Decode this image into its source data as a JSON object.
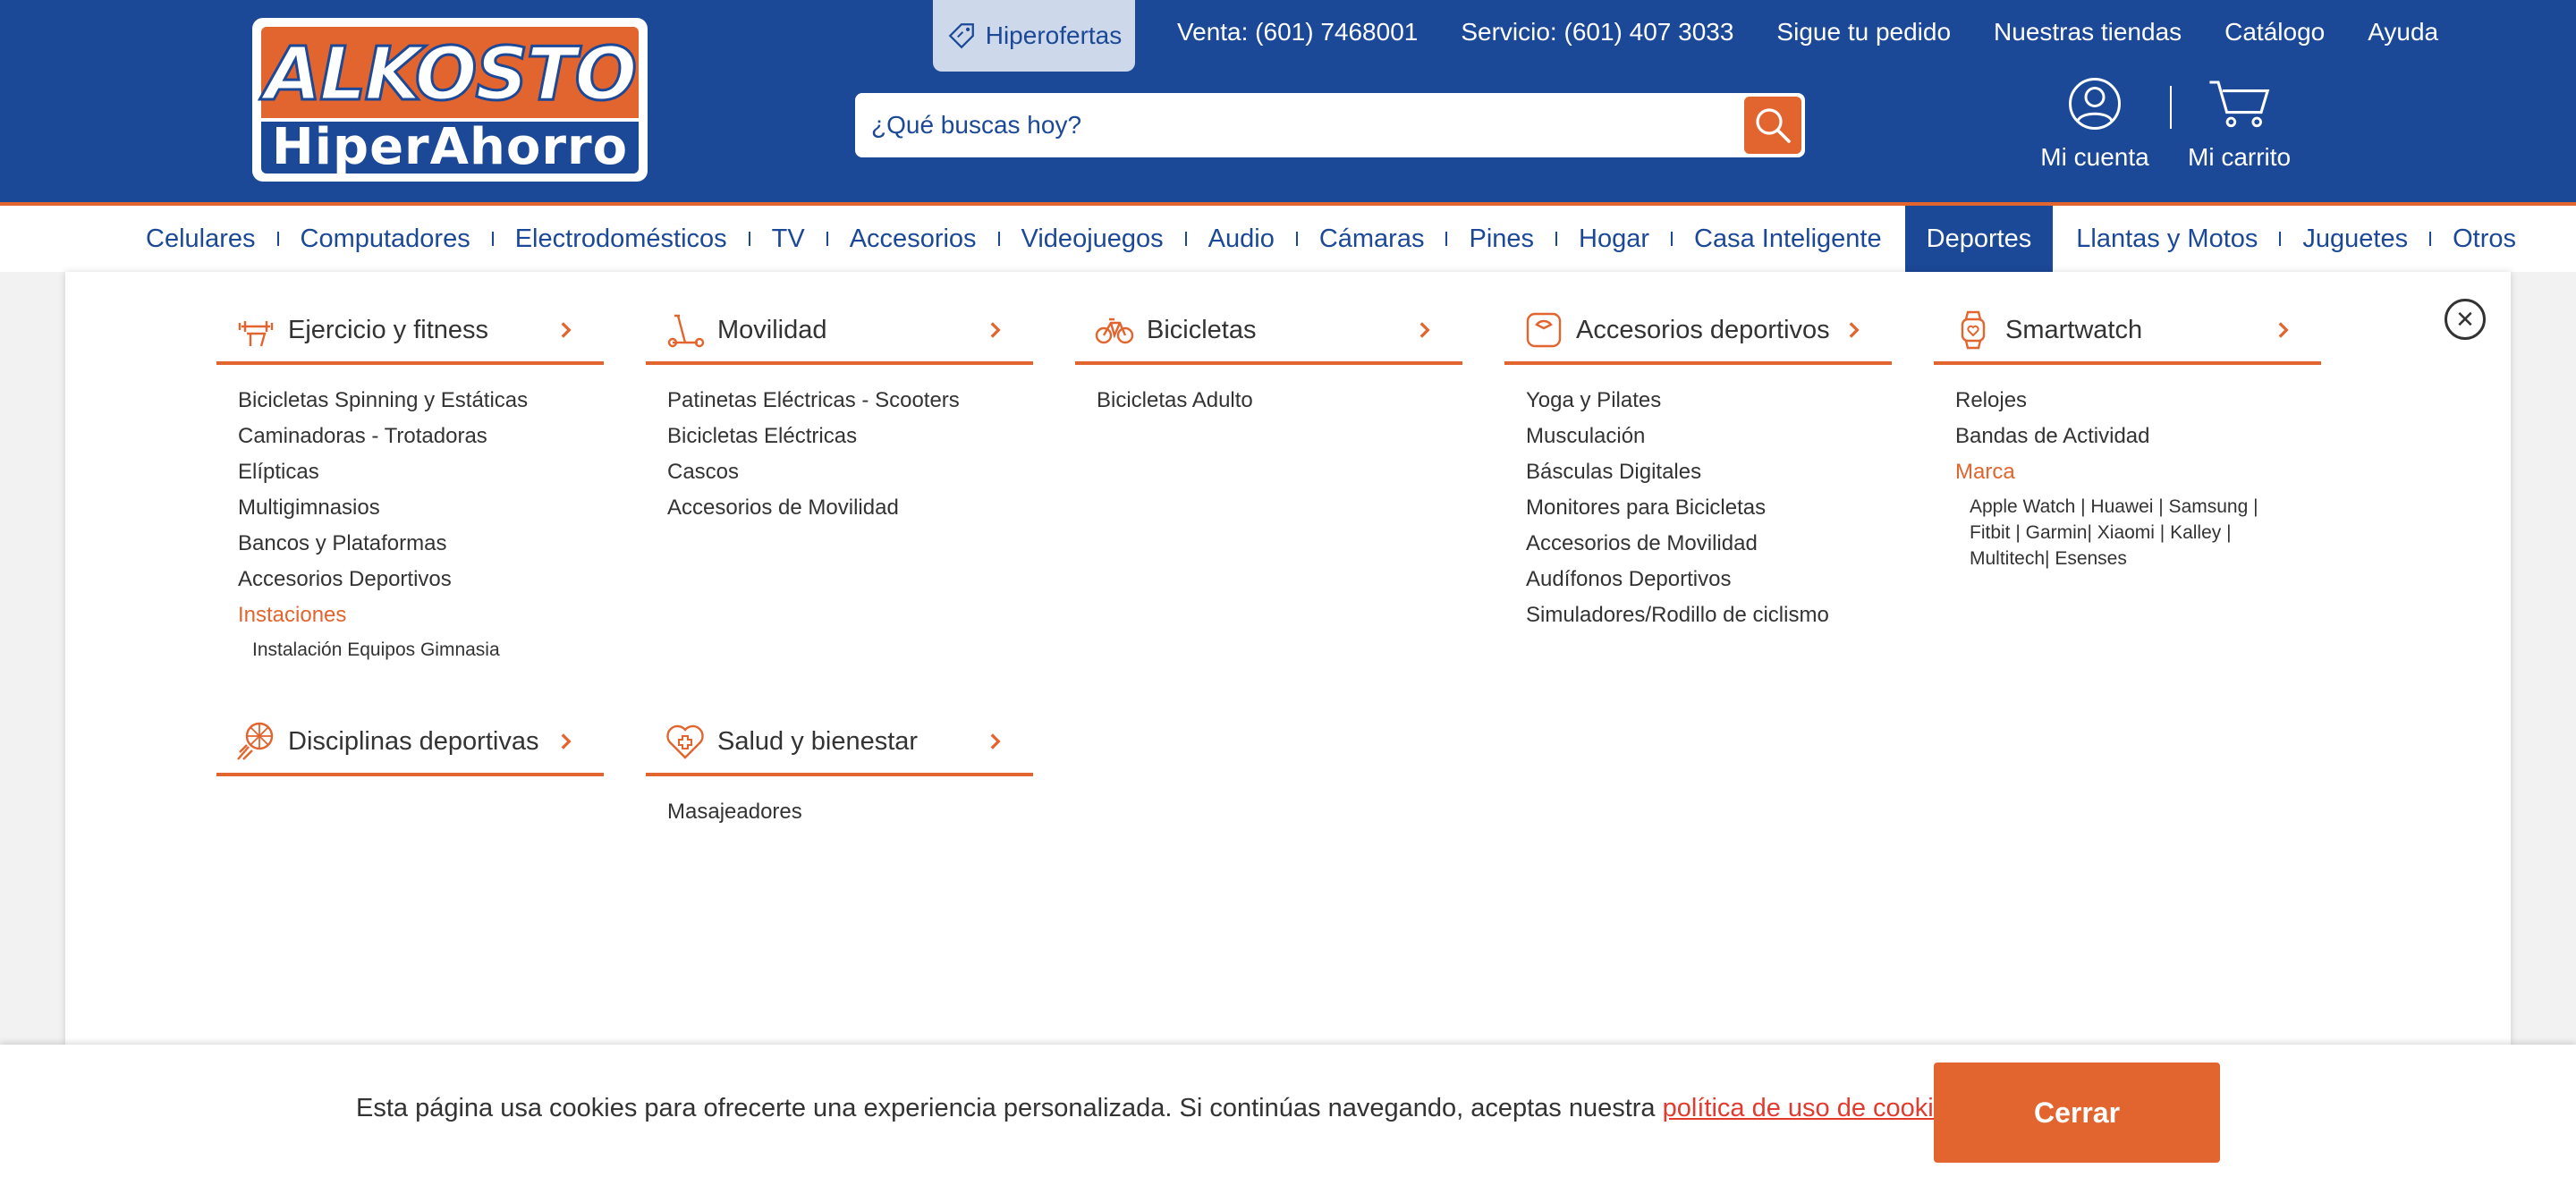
{
  "brand": {
    "line1": "ALKOSTO",
    "line2": "HiperAhorro"
  },
  "topbar": {
    "hiperofertas": "Hiperofertas",
    "links": [
      "Venta: (601) 7468001",
      "Servicio: (601) 407 3033",
      "Sigue tu pedido",
      "Nuestras tiendas",
      "Catálogo",
      "Ayuda"
    ]
  },
  "search": {
    "placeholder": "¿Qué buscas hoy?"
  },
  "account": {
    "label": "Mi cuenta"
  },
  "cart": {
    "label": "Mi carrito"
  },
  "categories": [
    "Celulares",
    "Computadores",
    "Electrodomésticos",
    "TV",
    "Accesorios",
    "Videojuegos",
    "Audio",
    "Cámaras",
    "Pines",
    "Hogar",
    "Casa Inteligente",
    "Deportes",
    "Llantas y Motos",
    "Juguetes",
    "Otros"
  ],
  "active_category": "Deportes",
  "menu": {
    "columns": [
      {
        "title": "Ejercicio y fitness",
        "icon": "fitness-icon",
        "items": [
          "Bicicletas Spinning y Estáticas",
          "Caminadoras - Trotadoras",
          "Elípticas",
          "Multigimnasios",
          "Bancos y Plataformas",
          "Accesorios Deportivos"
        ],
        "accent": "Instaciones",
        "sub": "Instalación Equipos Gimnasia"
      },
      {
        "title": "Movilidad",
        "icon": "scooter-icon",
        "items": [
          "Patinetas Eléctricas - Scooters",
          "Bicicletas Eléctricas",
          "Cascos",
          "Accesorios de Movilidad"
        ]
      },
      {
        "title": "Bicicletas",
        "icon": "bicycle-icon",
        "items": [
          "Bicicletas Adulto"
        ]
      },
      {
        "title": "Accesorios deportivos",
        "icon": "scale-icon",
        "items": [
          "Yoga y Pilates",
          "Musculación",
          "Básculas Digitales",
          "Monitores para Bicicletas",
          "Accesorios de Movilidad",
          "Audífonos Deportivos",
          "Simuladores/Rodillo de ciclismo"
        ]
      },
      {
        "title": "Smartwatch",
        "icon": "smartwatch-icon",
        "items": [
          "Relojes",
          "Bandas de Actividad"
        ],
        "accent": "Marca",
        "sub": "Apple Watch | Huawei | Samsung | Fitbit | Garmin| Xiaomi | Kalley | Multitech| Esenses"
      },
      {
        "title": "Disciplinas deportivas",
        "icon": "sports-ball-icon",
        "items": []
      },
      {
        "title": "Salud y bienestar",
        "icon": "health-heart-icon",
        "items": [
          "Masajeadores"
        ]
      }
    ]
  },
  "cookie": {
    "text": "Esta página usa cookies para ofrecerte una experiencia personalizada. Si continúas navegando, aceptas nuestra ",
    "link": "política de uso de cookies",
    "end": ".",
    "button": "Cerrar"
  },
  "colors": {
    "primary": "#1b4897",
    "accent": "#e2642e"
  }
}
